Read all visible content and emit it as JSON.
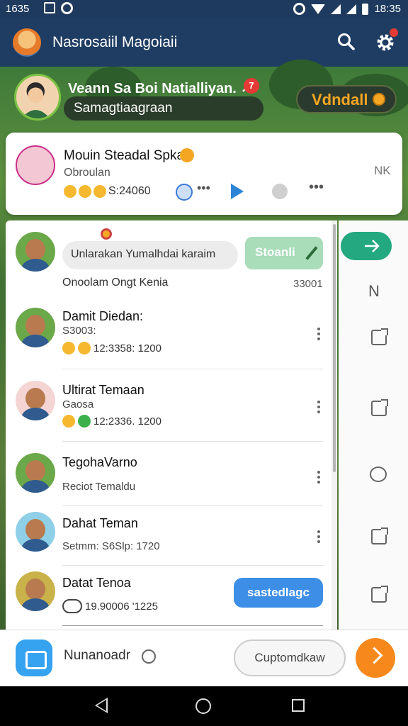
{
  "status_bar": {
    "time_left": "1635",
    "time_right": "18:35"
  },
  "app_bar": {
    "title": "Nasrosaiil Magoiaii"
  },
  "profile": {
    "name": "Veann Sa Boi Natialliyan. ↗",
    "badge": "7",
    "status": "Samagtiaagraan",
    "wallet_label": "Vdndall"
  },
  "featured": {
    "name": "Mouin Steadal Spka",
    "subtitle": "Obroulan",
    "meta": "S:24060"
  },
  "rows": [
    {
      "message": "Unlarakan Yumalhdai karaim",
      "button": "Stoanli",
      "name": "Onoolam Ongt Kenia",
      "time": "33001"
    },
    {
      "name": "Damit Diedan:",
      "sub": "S3003:",
      "meta": "12:3358: 1200"
    },
    {
      "name": "Ultirat Temaan",
      "sub": "Gaosa",
      "meta": "12:2336. 1200"
    },
    {
      "name": "TegohaVarno",
      "sub": "Reciot Temaldu"
    },
    {
      "name": "Dahat Teman",
      "sub": "Setmm: S6Slp: 1720"
    },
    {
      "name": "Datat Tenoa",
      "meta": "19.90006 '1225",
      "button": "sastedlagc"
    }
  ],
  "side_panel": {
    "letter": "N"
  },
  "composer": {
    "label": "Nunanoadr",
    "button": "Cuptomdkaw"
  }
}
